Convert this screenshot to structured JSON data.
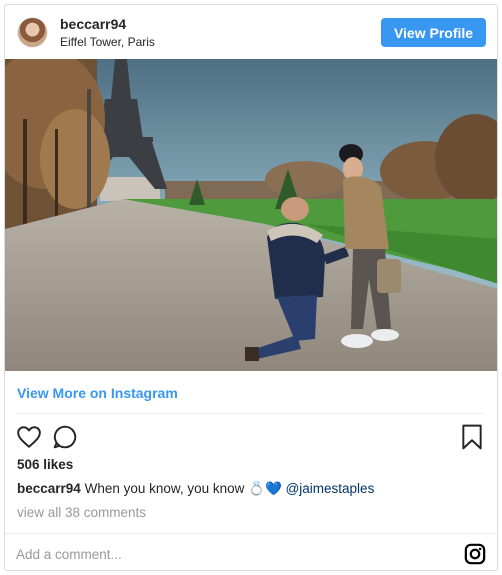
{
  "post": {
    "username": "beccarr94",
    "location": "Eiffel Tower, Paris",
    "view_profile_label": "View Profile",
    "view_more_label": "View More on Instagram",
    "likes": "506 likes",
    "caption_username": "beccarr94",
    "caption_text": "When you know, you know",
    "caption_emoji": "💍💙",
    "caption_mention": "@jaimestaples",
    "view_all_comments": "view all 38 comments",
    "comment_placeholder": "Add a comment..."
  },
  "icons": {
    "like": "heart-icon",
    "comment": "speech-bubble-icon",
    "save": "bookmark-icon",
    "brand": "instagram-icon"
  },
  "colors": {
    "accent": "#3897f0",
    "muted": "#999999",
    "border": "#dbdbdb",
    "text": "#262626"
  }
}
